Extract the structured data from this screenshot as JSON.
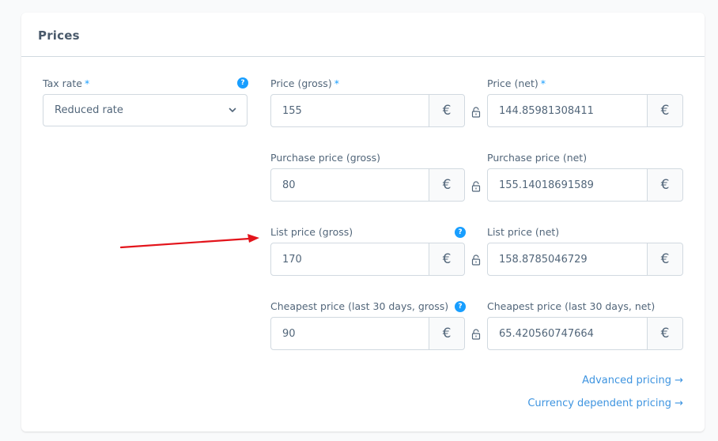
{
  "card": {
    "title": "Prices"
  },
  "tax_rate": {
    "label": "Tax rate",
    "required_marker": "*",
    "selected": "Reduced rate",
    "help_icon": "?"
  },
  "currency_symbol": "€",
  "price_rows": [
    {
      "gross": {
        "label": "Price (gross)",
        "required_marker": "*",
        "value": "155"
      },
      "net": {
        "label": "Price (net)",
        "required_marker": "*",
        "value": "144.85981308411"
      }
    },
    {
      "gross": {
        "label": "Purchase price (gross)",
        "value": "80"
      },
      "net": {
        "label": "Purchase price (net)",
        "value": "155.14018691589"
      }
    },
    {
      "gross": {
        "label": "List price (gross)",
        "value": "170",
        "help_icon": "?"
      },
      "net": {
        "label": "List price (net)",
        "value": "158.8785046729"
      }
    },
    {
      "gross": {
        "label": "Cheapest price (last 30 days, gross)",
        "value": "90",
        "help_icon": "?"
      },
      "net": {
        "label": "Cheapest price (last 30 days, net)",
        "value": "65.420560747664"
      }
    }
  ],
  "links": {
    "advanced_pricing": "Advanced pricing →",
    "currency_dependent_pricing": "Currency dependent pricing →"
  },
  "colors": {
    "accent": "#189eff",
    "link": "#3e94e0",
    "annotation_arrow": "#e3141b"
  }
}
